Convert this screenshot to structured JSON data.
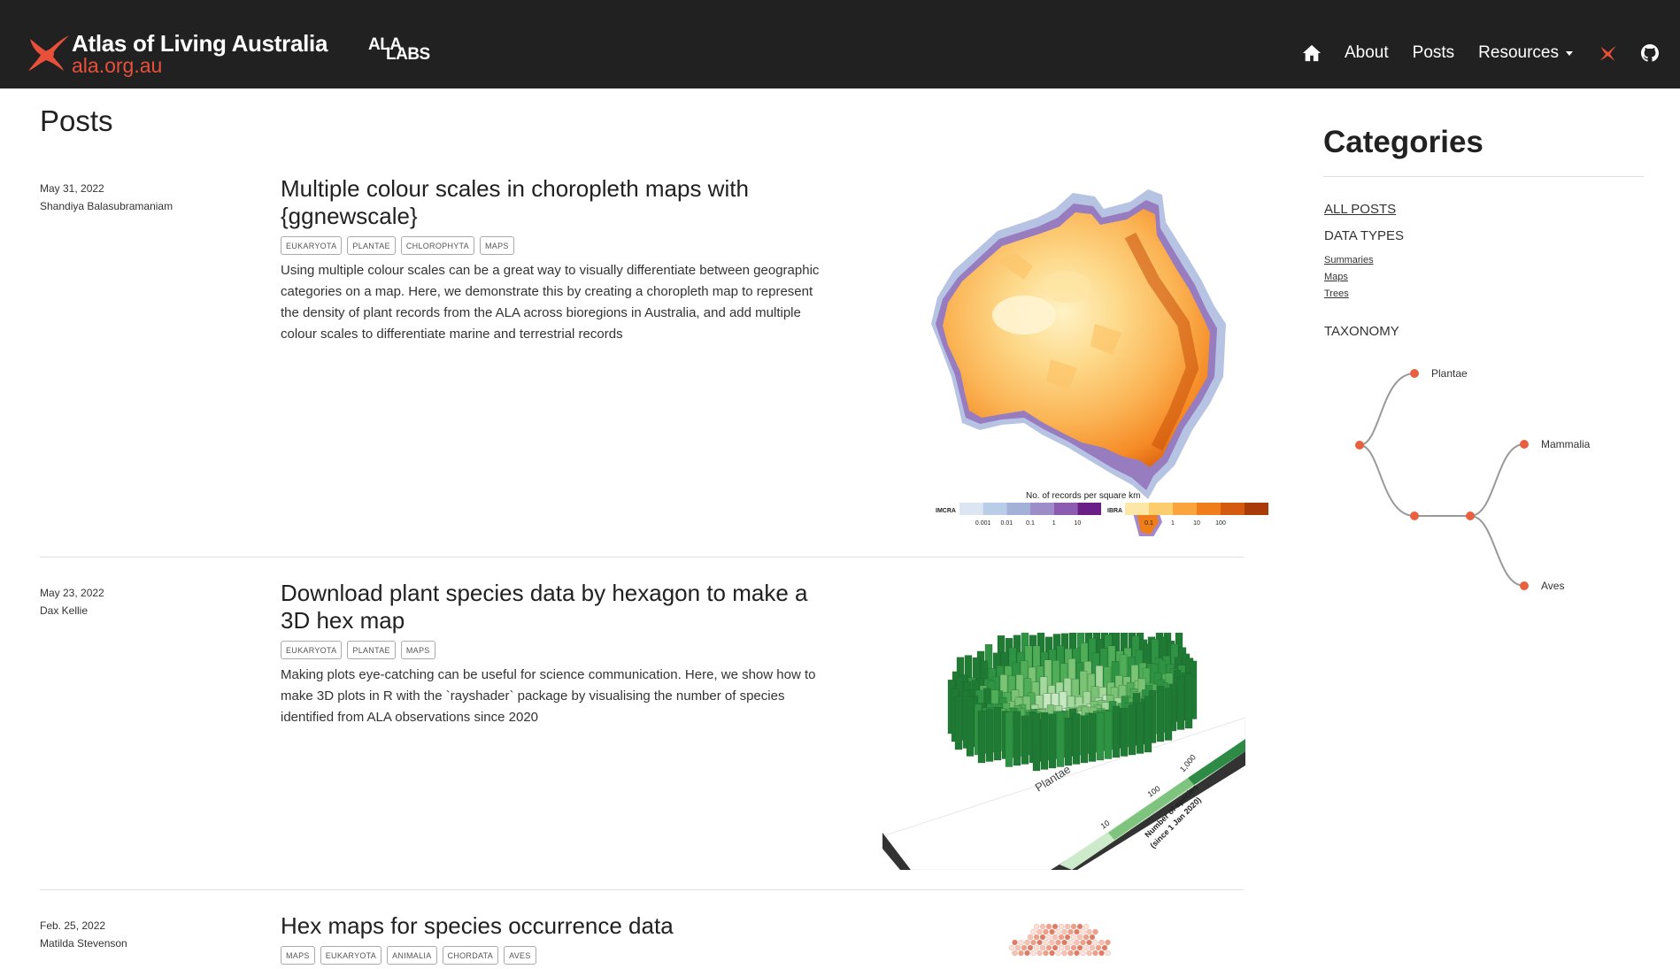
{
  "header": {
    "brand_title": "Atlas of Living Australia",
    "brand_url": "ala.org.au",
    "labs_top": "ALA",
    "labs_bottom": "LABS",
    "accent_color": "#e8503a",
    "nav": {
      "home_icon": "home-icon",
      "about": "About",
      "posts": "Posts",
      "resources": "Resources",
      "ala_icon": "ala-logo-icon",
      "github_icon": "github-icon"
    }
  },
  "page": {
    "title": "Posts"
  },
  "posts": [
    {
      "date": "May 31, 2022",
      "author": "Shandiya Balasubramaniam",
      "title": "Multiple colour scales in choropleth maps with {ggnewscale}",
      "tags": [
        "EUKARYOTA",
        "PLANTAE",
        "CHLOROPHYTA",
        "MAPS"
      ],
      "description": "Using multiple colour scales can be a great way to visually differentiate between geographic categories on a map. Here, we demonstrate this by creating a choropleth map to represent the density of plant records from the ALA across bioregions in Australia, and add multiple colour scales to differentiate marine and terrestrial records",
      "thumb": {
        "legend_title": "No. of records per square km",
        "imcra_label": "IMCRA",
        "ibra_label": "IBRA",
        "imcra_ticks": [
          "0.001",
          "0.01",
          "0.1",
          "1",
          "10"
        ],
        "ibra_ticks": [
          "0.1",
          "1",
          "10",
          "100"
        ],
        "imcra_colors": [
          "#dce6f3",
          "#b9cde8",
          "#a3b0d8",
          "#9c8cc8",
          "#8c5cb0",
          "#6a1f86"
        ],
        "ibra_colors": [
          "#fde7a6",
          "#fccd6c",
          "#f9a43c",
          "#ef7d1a",
          "#d35a0e",
          "#a83b08"
        ]
      }
    },
    {
      "date": "May 23, 2022",
      "author": "Dax Kellie",
      "title": "Download plant species data by hexagon to make a 3D hex map",
      "tags": [
        "EUKARYOTA",
        "PLANTAE",
        "MAPS"
      ],
      "description": "Making plots eye-catching can be useful for science communication. Here, we show how to make 3D plots in R with the `rayshader` package by visualising the number of species identified from ALA observations since 2020",
      "thumb": {
        "plot_label": "Plantae",
        "legend_title": "Number of species\n(since 1 Jan 2020)",
        "legend_ticks": [
          "10",
          "100",
          "1,000"
        ]
      }
    },
    {
      "date": "Feb. 25, 2022",
      "author": "Matilda Stevenson",
      "title": "Hex maps for species occurrence data",
      "tags": [
        "MAPS",
        "EUKARYOTA",
        "ANIMALIA",
        "CHORDATA",
        "AVES"
      ],
      "description": ""
    }
  ],
  "sidebar": {
    "title": "Categories",
    "all_posts": "ALL POSTS",
    "data_types_heading": "DATA TYPES",
    "data_types": [
      "Summaries",
      "Maps",
      "Trees"
    ],
    "taxonomy_heading": "TAXONOMY",
    "taxonomy_labels": [
      "Plantae",
      "Mammalia",
      "Aves"
    ]
  }
}
